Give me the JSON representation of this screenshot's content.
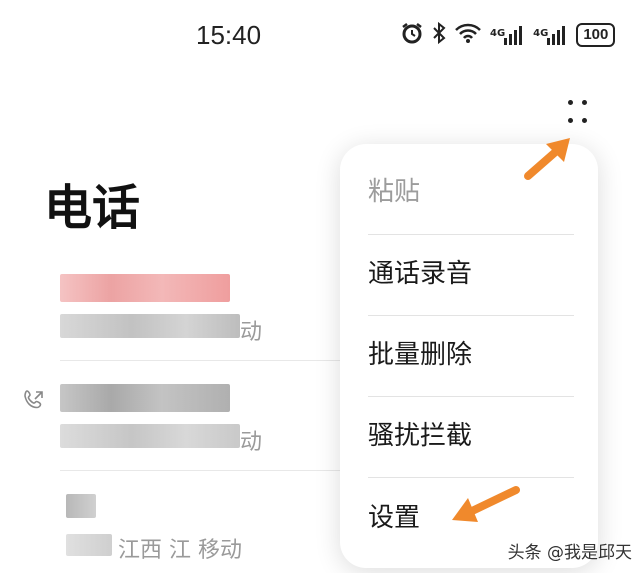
{
  "status_bar": {
    "time": "15:40",
    "signal_label_1": "4G",
    "signal_label_2": "4G",
    "battery": "100",
    "icons": [
      "alarm-icon",
      "bluetooth-icon",
      "wifi-icon",
      "signal-icon",
      "signal-icon",
      "battery-icon"
    ]
  },
  "header": {
    "title": "电话",
    "more_icon": "more-vertical-dots-icon"
  },
  "call_list": {
    "items": [
      {
        "location_suffix": "动",
        "missed": true
      },
      {
        "location_suffix": "动",
        "missed": false,
        "icon": "outgoing-call-icon"
      },
      {
        "location": "江西九江 移动",
        "location_visible": "江西 江 移动",
        "missed": false
      }
    ]
  },
  "menu": {
    "items": [
      {
        "label": "粘贴",
        "enabled": false
      },
      {
        "label": "通话录音",
        "enabled": true
      },
      {
        "label": "批量删除",
        "enabled": true
      },
      {
        "label": "骚扰拦截",
        "enabled": true
      },
      {
        "label": "设置",
        "enabled": true
      }
    ]
  },
  "annotations": {
    "arrow_color": "#f0892c"
  },
  "watermark": "头条 @我是邱天"
}
